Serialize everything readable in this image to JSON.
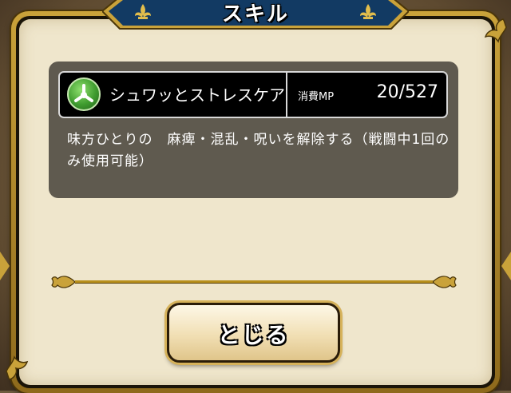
{
  "dialog": {
    "title": "スキル",
    "close_label": "とじる"
  },
  "skill": {
    "name": "シュワッとストレスケア",
    "icon": "green-three-way-emblem-icon",
    "mp_label": "消費MP",
    "mp_value": "20/527",
    "description": "味方ひとりの　麻痺・混乱・呪いを解除する（戦闘中1回のみ使用可能）"
  },
  "colors": {
    "frame_gold": "#c9a23a",
    "panel_cream": "#efe6cc",
    "title_navy": "#123a63",
    "info_box": "#5f5a4f",
    "skill_icon_green": "#3f9c2f"
  }
}
